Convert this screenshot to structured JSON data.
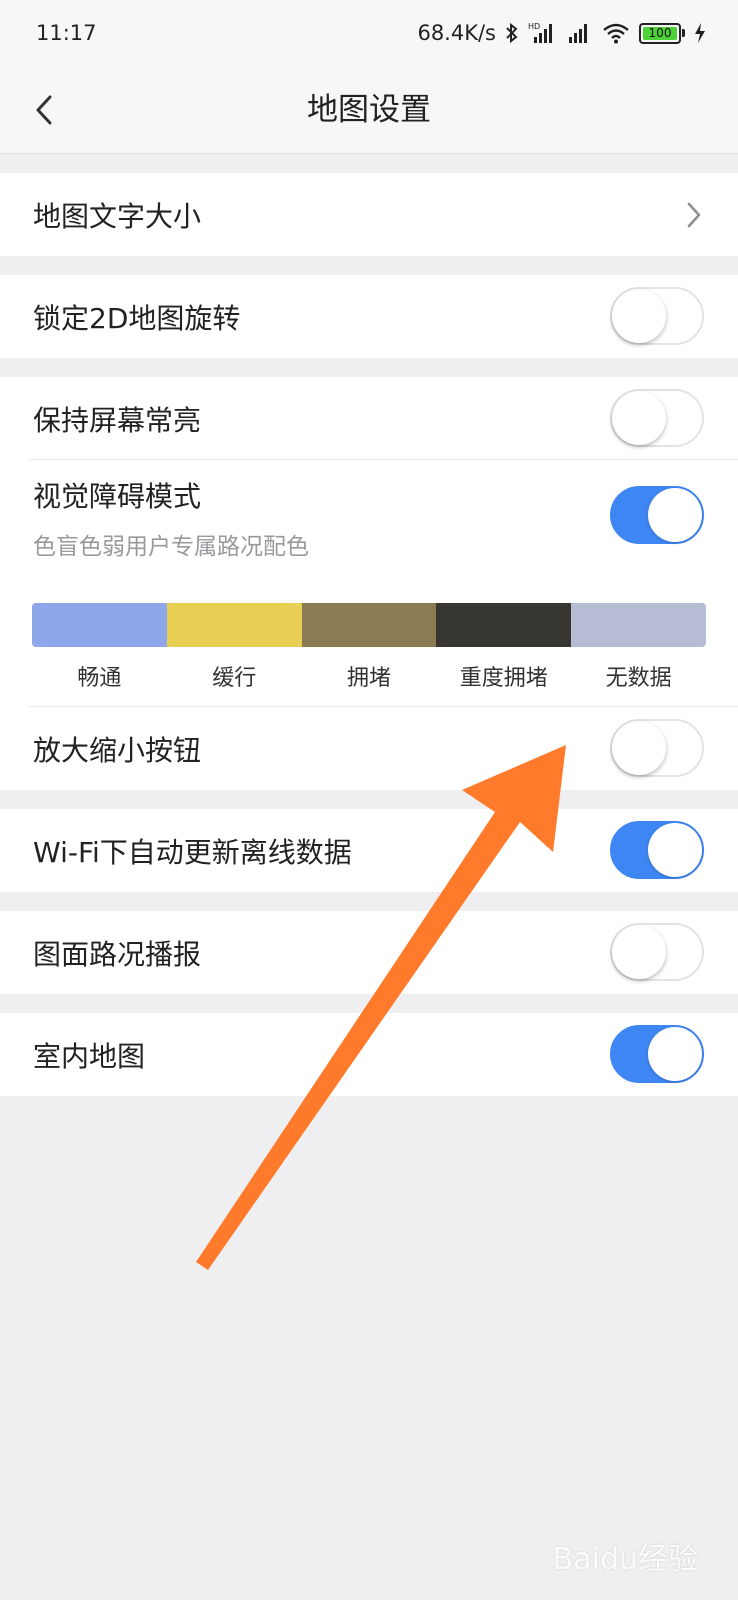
{
  "status_bar": {
    "time": "11:17",
    "network_speed": "68.4K/s",
    "battery_level": "100",
    "icons": [
      "bluetooth-icon",
      "hd-signal-icon",
      "signal-icon",
      "wifi-icon",
      "battery-icon",
      "charging-icon"
    ]
  },
  "navbar": {
    "title": "地图设置",
    "back_icon": "chevron-left-icon"
  },
  "settings": {
    "map_text_size": {
      "label": "地图文字大小"
    },
    "lock_2d_rotation": {
      "label": "锁定2D地图旋转",
      "on": false
    },
    "keep_screen_on": {
      "label": "保持屏幕常亮",
      "on": false
    },
    "vision_mode": {
      "label": "视觉障碍模式",
      "subtitle": "色盲色弱用户专属路况配色",
      "on": true,
      "legend": [
        {
          "label": "畅通",
          "color": "#8ea6ea"
        },
        {
          "label": "缓行",
          "color": "#e8d055"
        },
        {
          "label": "拥堵",
          "color": "#8a7b55"
        },
        {
          "label": "重度拥堵",
          "color": "#383630"
        },
        {
          "label": "无数据",
          "color": "#b5bcd3"
        }
      ]
    },
    "zoom_buttons": {
      "label": "放大缩小按钮",
      "on": false
    },
    "wifi_auto_update": {
      "label": "Wi-Fi下自动更新离线数据",
      "on": true
    },
    "traffic_broadcast": {
      "label": "图面路况播报",
      "on": false
    },
    "indoor_map": {
      "label": "室内地图",
      "on": true
    }
  },
  "colors": {
    "toggle_on": "#3e86f3",
    "annotation_arrow": "#ff7a2a",
    "background": "#efeff1"
  },
  "watermark": "Baidu经验"
}
